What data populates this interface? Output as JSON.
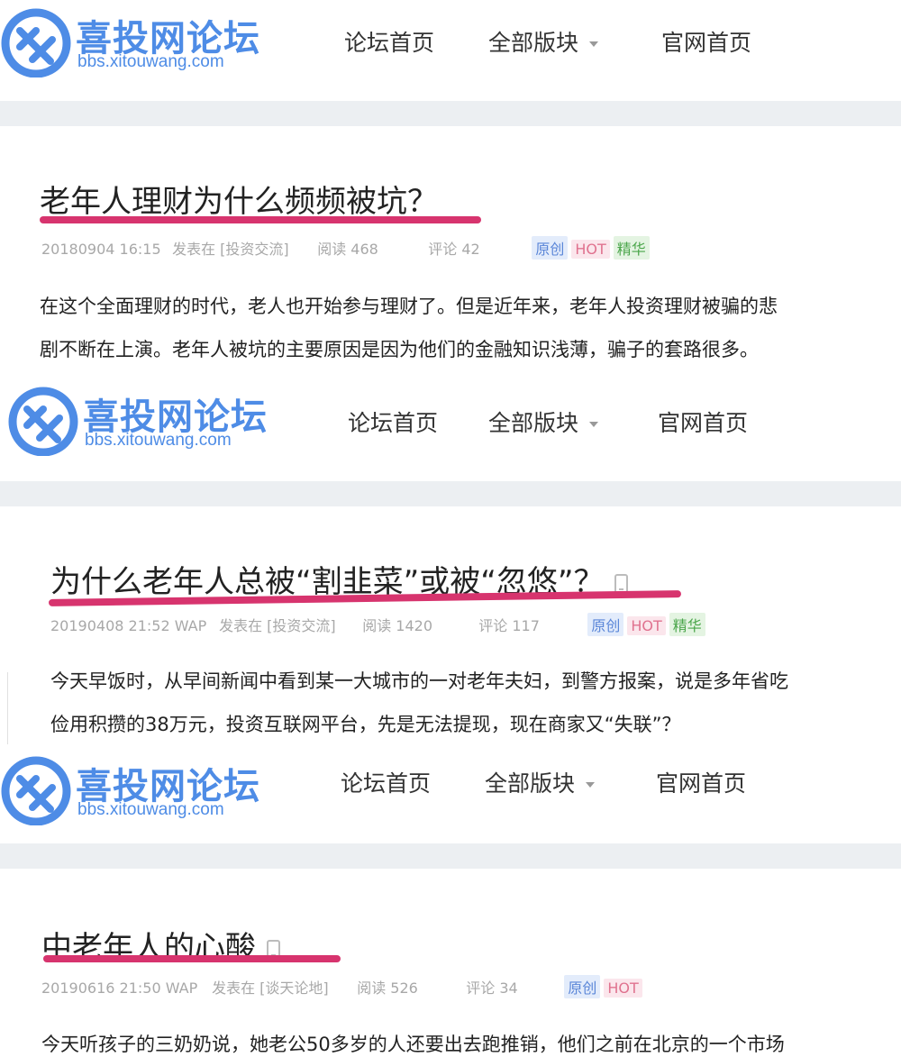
{
  "brand": {
    "name": "喜投网论坛",
    "url": "bbs.xitouwang.com",
    "color": "#4e8ce6"
  },
  "nav": {
    "home": "论坛首页",
    "sections": "全部版块",
    "official": "官网首页"
  },
  "accent": "#d7346e",
  "posts": [
    {
      "title": "老年人理财为什么频频被坑？",
      "date": "20180904 16:15",
      "posted_in": "发表在 [投资交流]",
      "reads": "阅读 468",
      "comments": "评论 42",
      "badges": [
        "原创",
        "HOT",
        "精华"
      ],
      "body": [
        "在这个全面理财的时代，老人也开始参与理财了。但是近年来，老年人投资理财被骗的悲",
        "剧不断在上演。老年人被坑的主要原因是因为他们的金融知识浅薄，骗子的套路很多。"
      ]
    },
    {
      "title": "为什么老年人总被“割韭菜”或被“忽悠”？",
      "date": "20190408 21:52 WAP",
      "posted_in": "发表在 [投资交流]",
      "reads": "阅读 1420",
      "comments": "评论 117",
      "badges": [
        "原创",
        "HOT",
        "精华"
      ],
      "body": [
        "今天早饭时，从早间新闻中看到某一大城市的一对老年夫妇，到警方报案，说是多年省吃",
        "俭用积攒的38万元，投资互联网平台，先是无法提现，现在商家又“失联”？"
      ]
    },
    {
      "title": "中老年人的心酸",
      "date": "20190616 21:50 WAP",
      "posted_in": "发表在 [谈天论地]",
      "reads": "阅读 526",
      "comments": "评论 34",
      "badges": [
        "原创",
        "HOT"
      ],
      "body": [
        "今天听孩子的三奶奶说，她老公50多岁的人还要出去跑推销，他们之前在北京的一个市场"
      ]
    }
  ]
}
